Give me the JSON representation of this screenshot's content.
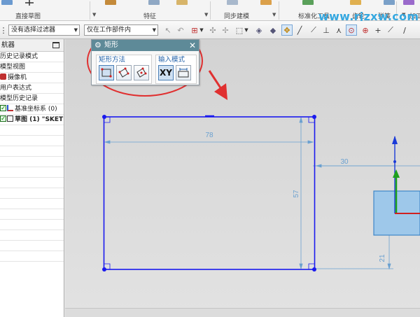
{
  "ribbon": {
    "groups": [
      {
        "label": "直接草图"
      },
      {
        "label": "特征"
      },
      {
        "label": "同步建模"
      },
      {
        "label": "标准化工具"
      },
      {
        "label": "齿轮"
      },
      {
        "label": "弹簧"
      },
      {
        "label": "加工"
      }
    ]
  },
  "watermark": "www.rjzxw.com",
  "toolbar": {
    "filter_combo": "没有选择过滤器",
    "scope_combo": "仅在工作部件内"
  },
  "navigator": {
    "title": "航器",
    "rows": [
      {
        "text": "历史记录模式"
      },
      {
        "text": "模型视图"
      },
      {
        "text": "摄像机"
      },
      {
        "text": "用户表达式"
      },
      {
        "text": "模型历史记录"
      },
      {
        "text": "基准坐标系 (0)"
      },
      {
        "text": "草图 (1) \"SKET"
      }
    ]
  },
  "dialog": {
    "title": "矩形",
    "method_label": "矩形方法",
    "input_label": "输入模式",
    "xy_label": "XY"
  },
  "dimensions": {
    "width": "78",
    "height": "57",
    "offset_x": "30",
    "offset_y": "21"
  },
  "colors": {
    "sketch_line": "#1a1aee",
    "dim_line": "#6aa0d0",
    "annotation_red": "#e03030",
    "dialog_title": "#5e8a98",
    "csys_blue": "#1a3ad8",
    "csys_green": "#1ea01e",
    "csys_red": "#d02020",
    "block_fill": "#9ec8ea"
  }
}
